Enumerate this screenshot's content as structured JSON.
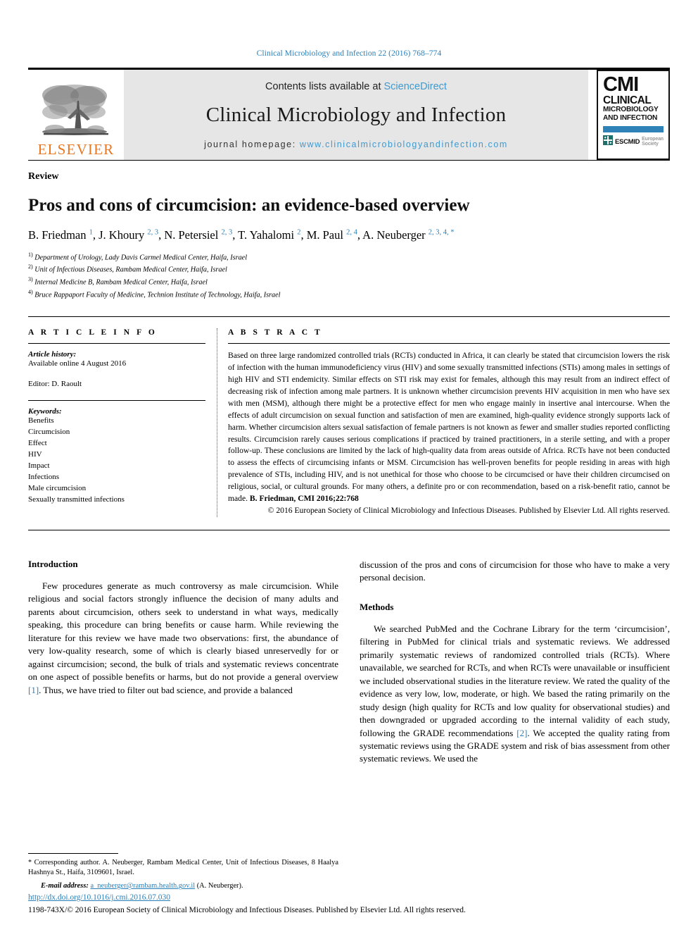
{
  "running_head": "Clinical Microbiology and Infection 22 (2016) 768–774",
  "masthead": {
    "publisher_name": "ELSEVIER",
    "contents_prefix": "Contents lists available at ",
    "contents_link": "ScienceDirect",
    "journal_name": "Clinical Microbiology and Infection",
    "homepage_prefix": "journal homepage: ",
    "homepage_url": "www.clinicalmicrobiologyandinfection.com",
    "cmi_logo": {
      "acronym": "CMI",
      "line1": "CLINICAL",
      "line2": "MICROBIOLOGY",
      "line3": "AND INFECTION",
      "society": "ESCMID",
      "society_sub": "European Society",
      "bar_color": "#2f82b8"
    }
  },
  "article": {
    "type": "Review",
    "title": "Pros and cons of circumcision: an evidence-based overview",
    "authors": [
      {
        "name": "B. Friedman",
        "sup": "1"
      },
      {
        "name": "J. Khoury",
        "sup": "2, 3"
      },
      {
        "name": "N. Petersiel",
        "sup": "2, 3"
      },
      {
        "name": "T. Yahalomi",
        "sup": "2"
      },
      {
        "name": "M. Paul",
        "sup": "2, 4"
      },
      {
        "name": "A. Neuberger",
        "sup": "2, 3, 4, *"
      }
    ],
    "affiliations": [
      {
        "marker": "1)",
        "text": "Department of Urology, Lady Davis Carmel Medical Center, Haifa, Israel"
      },
      {
        "marker": "2)",
        "text": "Unit of Infectious Diseases, Rambam Medical Center, Haifa, Israel"
      },
      {
        "marker": "3)",
        "text": "Internal Medicine B, Rambam Medical Center, Haifa, Israel"
      },
      {
        "marker": "4)",
        "text": "Bruce Rappaport Faculty of Medicine, Technion Institute of Technology, Haifa, Israel"
      }
    ]
  },
  "article_info": {
    "heading": "A R T I C L E   I N F O",
    "history_label": "Article history:",
    "history_value": "Available online 4 August 2016",
    "editor_line": "Editor: D. Raoult",
    "keywords_label": "Keywords:",
    "keywords": [
      "Benefits",
      "Circumcision",
      "Effect",
      "HIV",
      "Impact",
      "Infections",
      "Male circumcision",
      "Sexually transmitted infections"
    ]
  },
  "abstract": {
    "heading": "A B S T R A C T",
    "body": "Based on three large randomized controlled trials (RCTs) conducted in Africa, it can clearly be stated that circumcision lowers the risk of infection with the human immunodeficiency virus (HIV) and some sexually transmitted infections (STIs) among males in settings of high HIV and STI endemicity. Similar effects on STI risk may exist for females, although this may result from an indirect effect of decreasing risk of infection among male partners. It is unknown whether circumcision prevents HIV acquisition in men who have sex with men (MSM), although there might be a protective effect for men who engage mainly in insertive anal intercourse. When the effects of adult circumcision on sexual function and satisfaction of men are examined, high-quality evidence strongly supports lack of harm. Whether circumcision alters sexual satisfaction of female partners is not known as fewer and smaller studies reported conflicting results. Circumcision rarely causes serious complications if practiced by trained practitioners, in a sterile setting, and with a proper follow-up. These conclusions are limited by the lack of high-quality data from areas outside of Africa. RCTs have not been conducted to assess the effects of circumcising infants or MSM. Circumcision has well-proven benefits for people residing in areas with high prevalence of STIs, including HIV, and is not unethical for those who choose to be circumcised or have their children circumcised on religious, social, or cultural grounds. For many others, a definite pro or con recommendation, based on a risk-benefit ratio, cannot be made.",
    "citation": "B. Friedman, CMI 2016;22:768",
    "copyright": "© 2016 European Society of Clinical Microbiology and Infectious Diseases. Published by Elsevier Ltd. All rights reserved."
  },
  "body": {
    "left": {
      "intro_heading": "Introduction",
      "intro_p1_a": "Few procedures generate as much controversy as male circumcision. While religious and social factors strongly influence the decision of many adults and parents about circumcision, others seek to understand in what ways, medically speaking, this procedure can bring benefits or cause harm. While reviewing the literature for this review we have made two observations: first, the abundance of very low-quality research, some of which is clearly biased unreservedly for or against circumcision; second, the bulk of trials and systematic reviews concentrate on one aspect of possible benefits or harms, but do not provide a general overview ",
      "intro_ref1": "[1]",
      "intro_p1_b": ". Thus, we have tried to filter out bad science, and provide a balanced"
    },
    "right": {
      "intro_cont": "discussion of the pros and cons of circumcision for those who have to make a very personal decision.",
      "methods_heading": "Methods",
      "methods_p1_a": "We searched PubMed and the Cochrane Library for the term ‘circumcision’, filtering in PubMed for clinical trials and systematic reviews. We addressed primarily systematic reviews of randomized controlled trials (RCTs). Where unavailable, we searched for RCTs, and when RCTs were unavailable or insufficient we included observational studies in the literature review. We rated the quality of the evidence as very low, low, moderate, or high. We based the rating primarily on the study design (high quality for RCTs and low quality for observational studies) and then downgraded or upgraded according to the internal validity of each study, following the GRADE recommendations ",
      "methods_ref2": "[2]",
      "methods_p1_b": ". We accepted the quality rating from systematic reviews using the GRADE system and risk of bias assessment from other systematic reviews. We used the"
    }
  },
  "footnotes": {
    "corresponding": "Corresponding author. A. Neuberger, Rambam Medical Center, Unit of Infectious Diseases, 8 Haalya Hashnya St., Haifa, 3109601, Israel.",
    "corresponding_marker": "*",
    "email_label": "E-mail address:",
    "email": "a_neuberger@rambam.health.gov.il",
    "email_attribution": "(A. Neuberger)."
  },
  "footer": {
    "doi": "http://dx.doi.org/10.1016/j.cmi.2016.07.030",
    "issn_line": "1198-743X/© 2016 European Society of Clinical Microbiology and Infectious Diseases. Published by Elsevier Ltd. All rights reserved."
  },
  "colors": {
    "link_blue": "#2b7fb8",
    "sciencedirect_blue": "#3f9ad0",
    "elsevier_orange": "#e87722",
    "band_gray": "#e6e6e6"
  }
}
